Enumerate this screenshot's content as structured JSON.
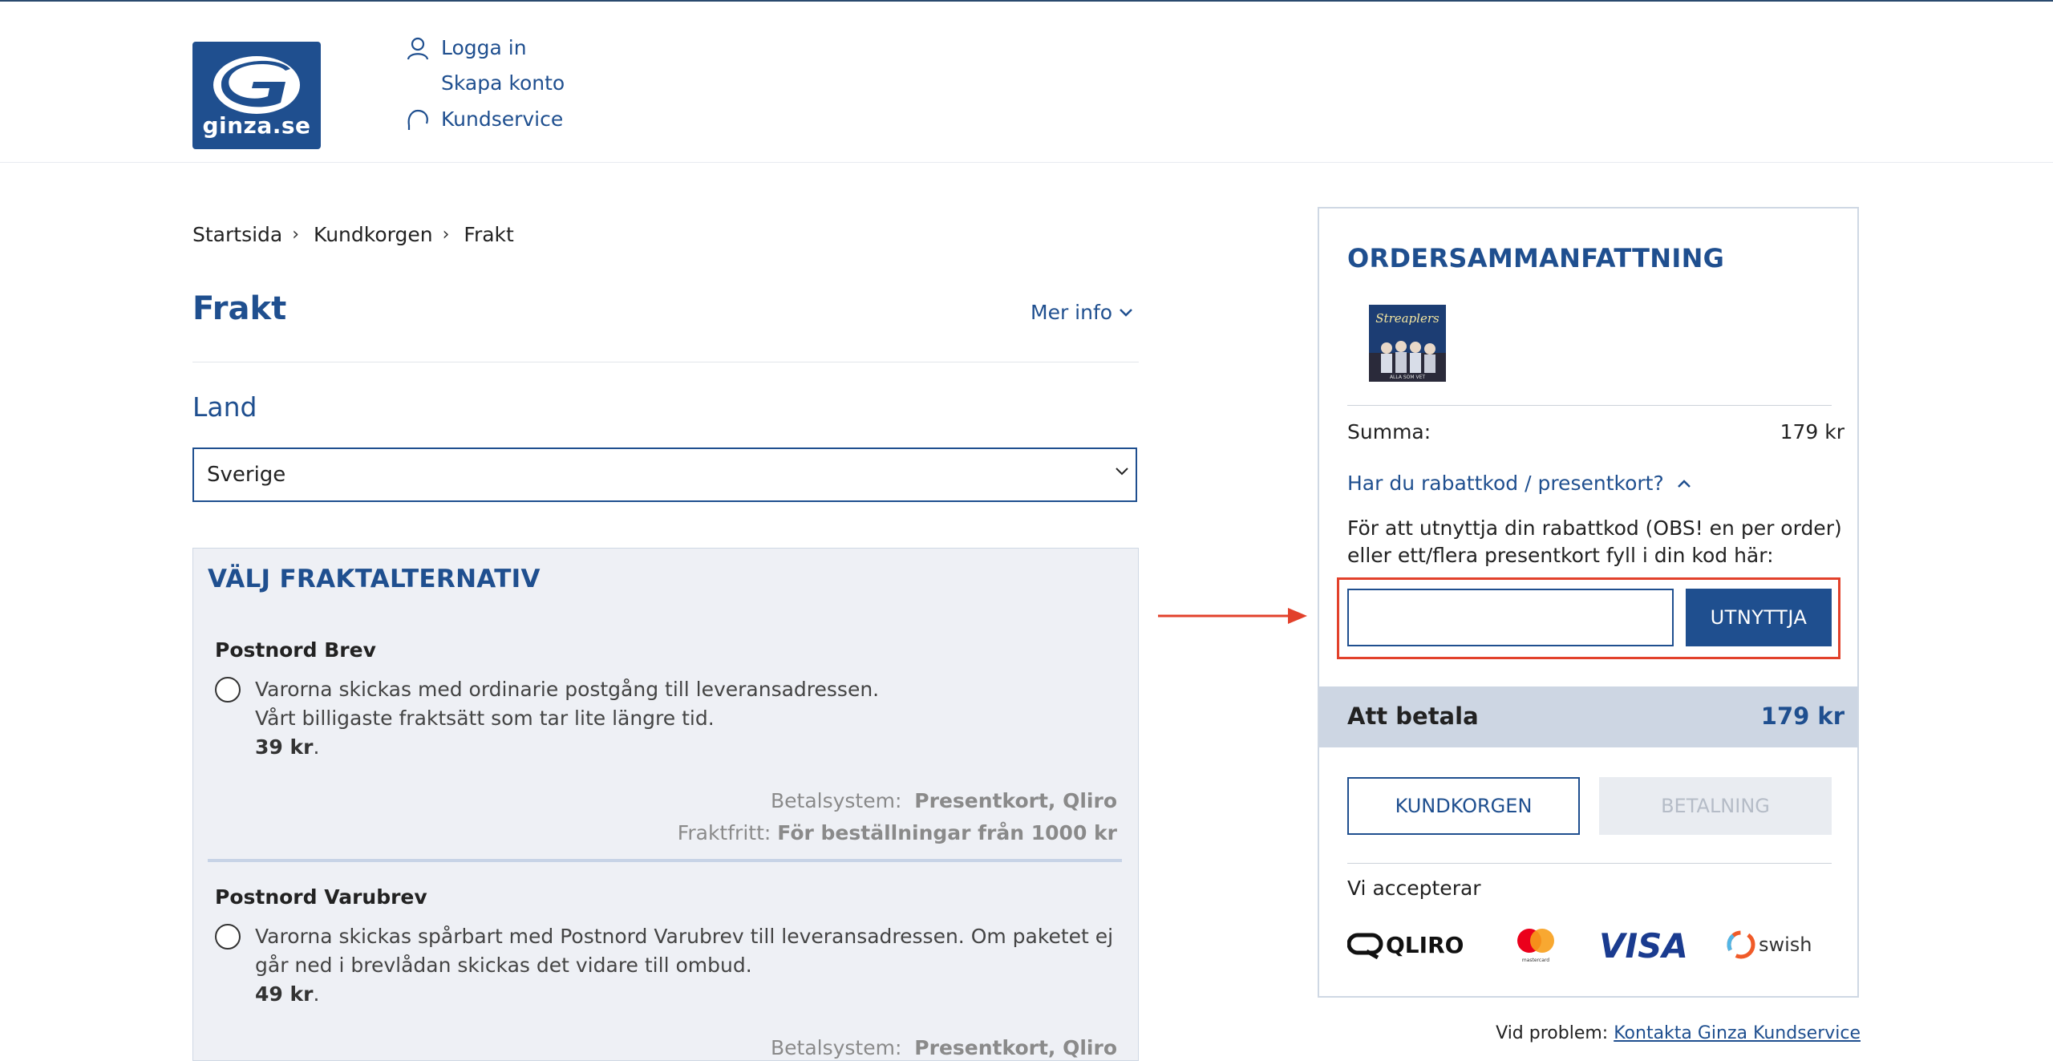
{
  "header": {
    "logo_text": "ginza.se",
    "login": "Logga in",
    "create_account": "Skapa konto",
    "customer_service": "Kundservice"
  },
  "breadcrumb": [
    "Startsida",
    "Kundkorgen",
    "Frakt"
  ],
  "page": {
    "title": "Frakt",
    "more_info": "Mer info",
    "country_label": "Land",
    "country_value": "Sverige"
  },
  "shipping": {
    "title": "VÄLJ FRAKTALTERNATIV",
    "options": [
      {
        "name": "Postnord Brev",
        "line1": "Varorna skickas med ordinarie postgång till leveransadressen.",
        "line2": "Vårt billigaste fraktsätt som tar lite längre tid.",
        "price": "39 kr",
        "payment_label": "Betalsystem:",
        "payment_value": "Presentkort, Qliro",
        "free_label": "Fraktfritt:",
        "free_value": "För beställningar från 1000 kr"
      },
      {
        "name": "Postnord Varubrev",
        "line1": "Varorna skickas spårbart med Postnord Varubrev till leveransadressen. Om paketet ej",
        "line2": "går ned i brevlådan skickas det vidare till ombud.",
        "price": "49 kr",
        "payment_label": "Betalsystem:",
        "payment_value": "Presentkort, Qliro"
      }
    ]
  },
  "summary": {
    "title": "ORDERSAMMANFATTNING",
    "album_text": "Streaplers",
    "album_subtitle": "ALLA SOM VET",
    "sum_label": "Summa:",
    "sum_value": "179 kr",
    "discount_toggle": "Har du rabattkod / presentkort?",
    "discount_note": "För att utnyttja din rabattkod (OBS! en per order) eller ett/flera presentkort fyll i din kod här:",
    "discount_input_value": "",
    "apply_button": "UTNYTTJA",
    "to_pay_label": "Att betala",
    "to_pay_value": "179 kr",
    "cart_button": "KUNDKORGEN",
    "pay_button": "BETALNING",
    "accept_label": "Vi accepterar",
    "payment_methods": [
      "QLIRO",
      "mastercard",
      "VISA",
      "swish"
    ]
  },
  "footer": {
    "problem_label": "Vid problem:",
    "problem_link": "Kontakta Ginza Kundservice"
  },
  "colors": {
    "brand": "#1f4f8f",
    "highlight": "#e2412b",
    "panel": "#eef0f5"
  }
}
